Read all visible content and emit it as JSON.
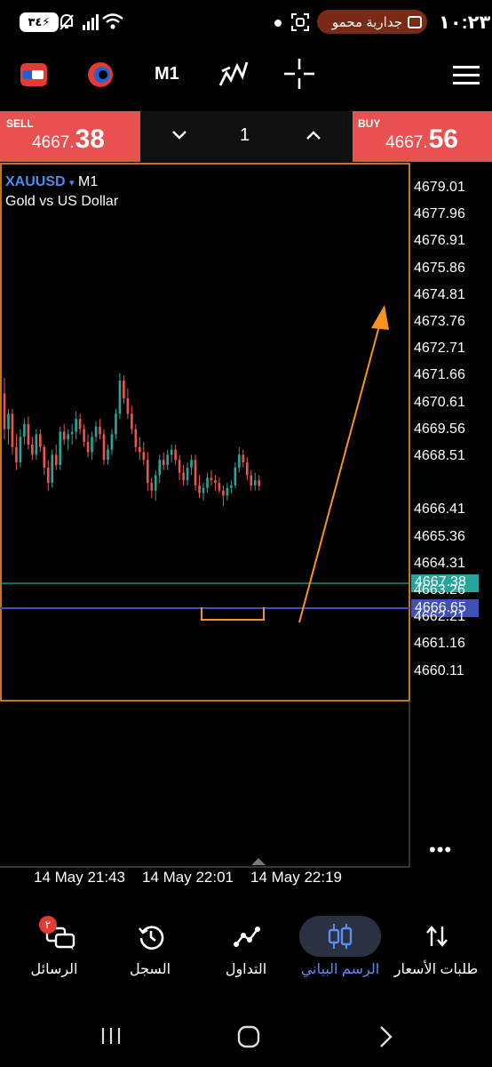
{
  "status_bar": {
    "time": "١٠:٢٣",
    "notification_pill": "جدارية محمو",
    "battery": "٣٤"
  },
  "toolbar": {
    "timeframe": "M1"
  },
  "price_bar": {
    "sell_label": "SELL",
    "sell_price_main": "4667.",
    "sell_price_big": "38",
    "buy_label": "BUY",
    "buy_price_main": "4667.",
    "buy_price_big": "56",
    "lot": "1"
  },
  "chart": {
    "symbol": "XAUUSD",
    "symbol_arrow": "▾",
    "timeframe": "M1",
    "description": "Gold vs US Dollar",
    "y_axis": [
      "4679.01",
      "4677.96",
      "4676.91",
      "4675.86",
      "4674.81",
      "4673.76",
      "4672.71",
      "4671.66",
      "4670.61",
      "4669.56",
      "4668.51",
      "4666.41",
      "4665.36",
      "4664.31",
      "4663.26",
      "4662.21",
      "4661.16",
      "4660.11"
    ],
    "bid_tag": "4667.38",
    "line_tag": "4666.65",
    "x_axis": [
      "14 May 21:43",
      "14 May 22:01",
      "14 May 22:19"
    ],
    "colors": {
      "bull": "#26a69a",
      "bear": "#ef5350",
      "orange": "#f7931e",
      "blue_line": "#3f51b5",
      "bid_line": "#26a69a"
    }
  },
  "chart_data": {
    "type": "candlestick",
    "y_range": [
      4660.11,
      4679.01
    ],
    "candles": [
      [
        4671.0,
        4671.6,
        4669.2,
        4669.6
      ],
      [
        4669.6,
        4670.4,
        4669.0,
        4670.2
      ],
      [
        4670.2,
        4670.4,
        4668.6,
        4668.9
      ],
      [
        4668.9,
        4669.4,
        4668.0,
        4668.3
      ],
      [
        4668.3,
        4669.6,
        4668.1,
        4669.3
      ],
      [
        4669.3,
        4670.0,
        4669.0,
        4669.8
      ],
      [
        4669.8,
        4670.1,
        4668.8,
        4669.0
      ],
      [
        4669.0,
        4669.3,
        4668.4,
        4668.6
      ],
      [
        4668.6,
        4669.6,
        4668.4,
        4669.4
      ],
      [
        4669.4,
        4669.6,
        4668.7,
        4668.9
      ],
      [
        4668.9,
        4669.0,
        4667.8,
        4668.1
      ],
      [
        4668.1,
        4668.4,
        4667.2,
        4667.5
      ],
      [
        4667.5,
        4668.8,
        4667.3,
        4668.6
      ],
      [
        4668.6,
        4669.0,
        4668.0,
        4668.2
      ],
      [
        4668.2,
        4669.7,
        4668.0,
        4669.5
      ],
      [
        4669.5,
        4669.8,
        4669.0,
        4669.2
      ],
      [
        4669.2,
        4669.6,
        4668.8,
        4669.4
      ],
      [
        4669.4,
        4669.8,
        4669.0,
        4669.5
      ],
      [
        4669.5,
        4670.3,
        4669.2,
        4670.0
      ],
      [
        4670.0,
        4670.2,
        4669.4,
        4669.6
      ],
      [
        4669.6,
        4669.8,
        4668.9,
        4669.1
      ],
      [
        4669.1,
        4669.4,
        4668.5,
        4668.7
      ],
      [
        4668.7,
        4669.5,
        4668.4,
        4669.3
      ],
      [
        4669.3,
        4669.9,
        4669.1,
        4669.7
      ],
      [
        4669.7,
        4670.0,
        4669.2,
        4669.4
      ],
      [
        4669.4,
        4669.6,
        4668.2,
        4668.4
      ],
      [
        4668.4,
        4669.0,
        4668.2,
        4668.8
      ],
      [
        4668.8,
        4669.6,
        4668.6,
        4669.4
      ],
      [
        4669.4,
        4670.4,
        4669.2,
        4670.2
      ],
      [
        4670.2,
        4671.8,
        4670.0,
        4671.5
      ],
      [
        4671.5,
        4671.7,
        4670.6,
        4670.8
      ],
      [
        4670.8,
        4671.2,
        4670.0,
        4670.2
      ],
      [
        4670.2,
        4670.5,
        4669.4,
        4669.6
      ],
      [
        4669.6,
        4669.8,
        4668.7,
        4668.9
      ],
      [
        4668.9,
        4669.3,
        4668.4,
        4668.7
      ],
      [
        4668.7,
        4669.1,
        4668.2,
        4668.4
      ],
      [
        4668.4,
        4668.7,
        4667.2,
        4667.5
      ],
      [
        4667.5,
        4667.7,
        4666.9,
        4667.2
      ],
      [
        4667.2,
        4668.0,
        4666.8,
        4667.8
      ],
      [
        4667.8,
        4668.6,
        4667.5,
        4668.4
      ],
      [
        4668.4,
        4668.7,
        4668.0,
        4668.2
      ],
      [
        4668.2,
        4668.8,
        4668.0,
        4668.6
      ],
      [
        4668.6,
        4669.0,
        4668.3,
        4668.8
      ],
      [
        4668.8,
        4669.0,
        4668.2,
        4668.4
      ],
      [
        4668.4,
        4668.6,
        4667.6,
        4667.9
      ],
      [
        4667.9,
        4668.2,
        4667.4,
        4667.6
      ],
      [
        4667.6,
        4668.3,
        4667.4,
        4668.1
      ],
      [
        4668.1,
        4668.6,
        4667.8,
        4668.4
      ],
      [
        4668.4,
        4668.6,
        4667.2,
        4667.4
      ],
      [
        4667.4,
        4667.8,
        4666.9,
        4667.1
      ],
      [
        4667.1,
        4667.5,
        4666.8,
        4667.3
      ],
      [
        4667.3,
        4667.9,
        4667.1,
        4667.7
      ],
      [
        4667.7,
        4668.0,
        4667.4,
        4667.6
      ],
      [
        4667.6,
        4667.8,
        4667.2,
        4667.5
      ],
      [
        4667.5,
        4667.7,
        4667.1,
        4667.2
      ],
      [
        4667.2,
        4667.4,
        4666.6,
        4667.0
      ],
      [
        4667.0,
        4667.5,
        4666.8,
        4667.3
      ],
      [
        4667.3,
        4667.6,
        4667.1,
        4667.4
      ],
      [
        4667.4,
        4668.3,
        4667.3,
        4668.1
      ],
      [
        4668.1,
        4668.9,
        4667.9,
        4668.6
      ],
      [
        4668.6,
        4668.8,
        4668.1,
        4668.3
      ],
      [
        4668.3,
        4668.5,
        4667.6,
        4667.8
      ],
      [
        4667.8,
        4668.0,
        4667.2,
        4667.4
      ],
      [
        4667.4,
        4667.9,
        4667.2,
        4667.6
      ],
      [
        4667.6,
        4667.8,
        4667.2,
        4667.38
      ]
    ]
  },
  "nav": {
    "items": [
      {
        "label": "طلبات الأسعار"
      },
      {
        "label": "الرسم البياني"
      },
      {
        "label": "التداول"
      },
      {
        "label": "السجل"
      },
      {
        "label": "الرسائل"
      }
    ],
    "badge": "٢"
  }
}
